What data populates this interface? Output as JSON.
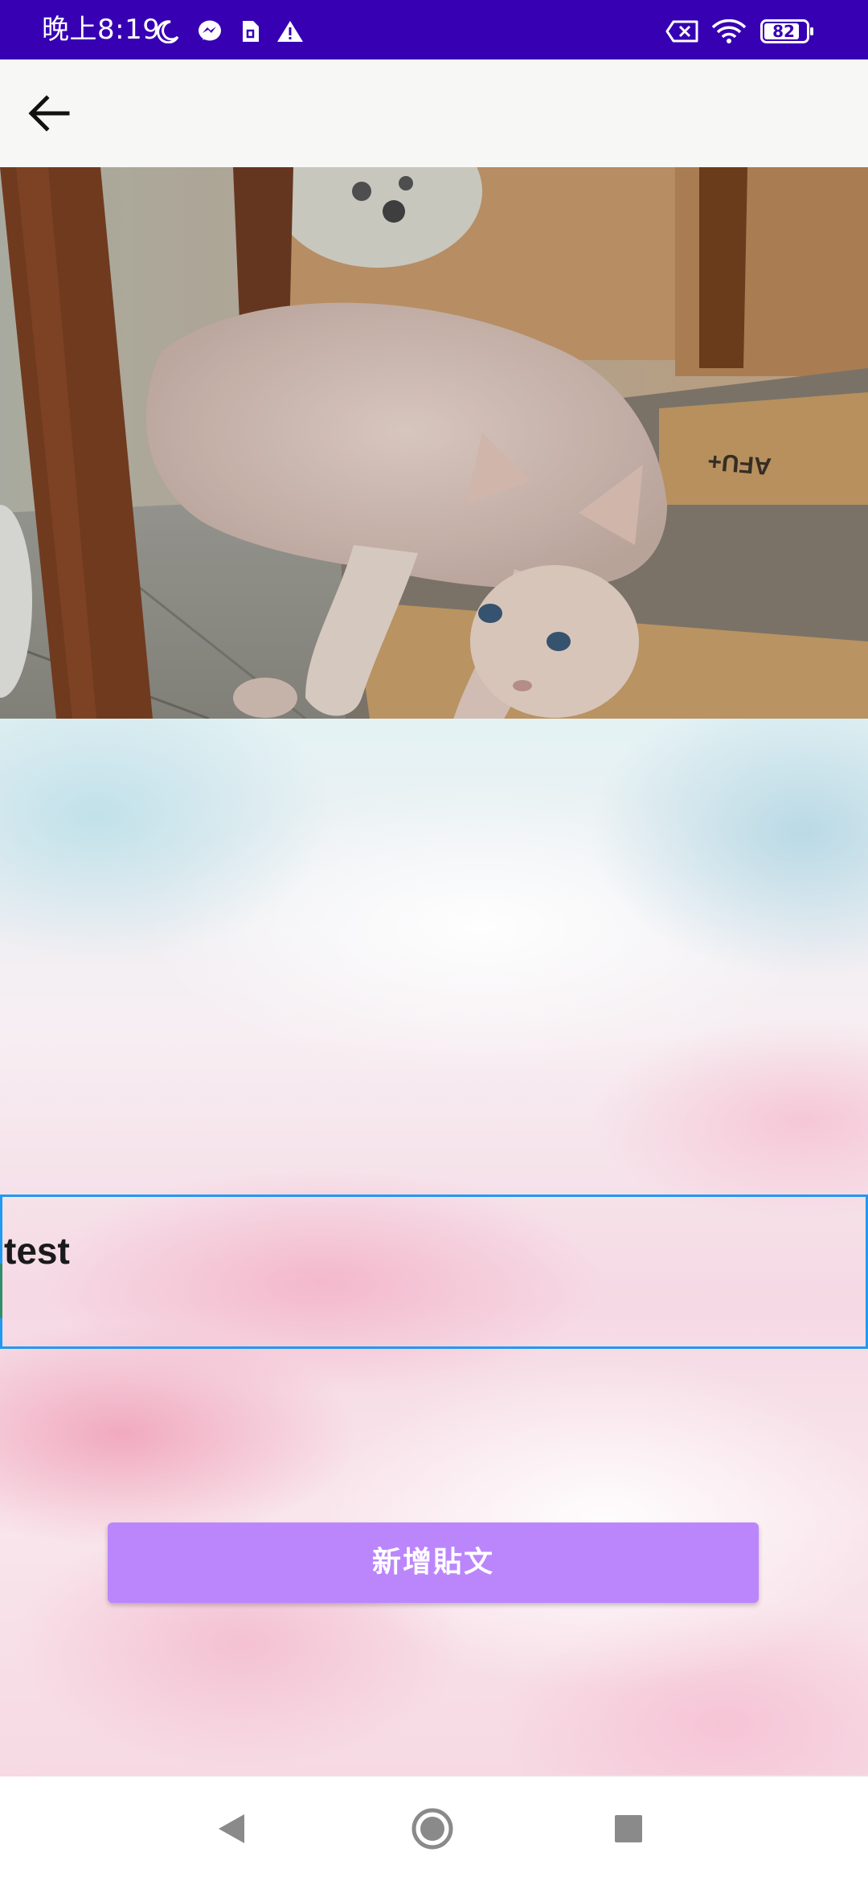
{
  "status_bar": {
    "time": "晚上8:19",
    "battery": "82",
    "icons": [
      "moon-icon",
      "messenger-icon",
      "sim-card-icon",
      "warning-icon",
      "no-sim-icon",
      "wifi-icon",
      "battery-icon"
    ],
    "background_color": "#3700b3"
  },
  "app_bar": {
    "back_icon": "arrow-back-icon"
  },
  "photo": {
    "subject": "cat"
  },
  "post_input": {
    "value": "test",
    "border_color": "#1e9af2"
  },
  "submit_button": {
    "label": "新增貼文",
    "color": "#bb86fc"
  },
  "nav_bar": {
    "buttons": [
      "nav-back-icon",
      "nav-home-icon",
      "nav-recents-icon"
    ]
  }
}
